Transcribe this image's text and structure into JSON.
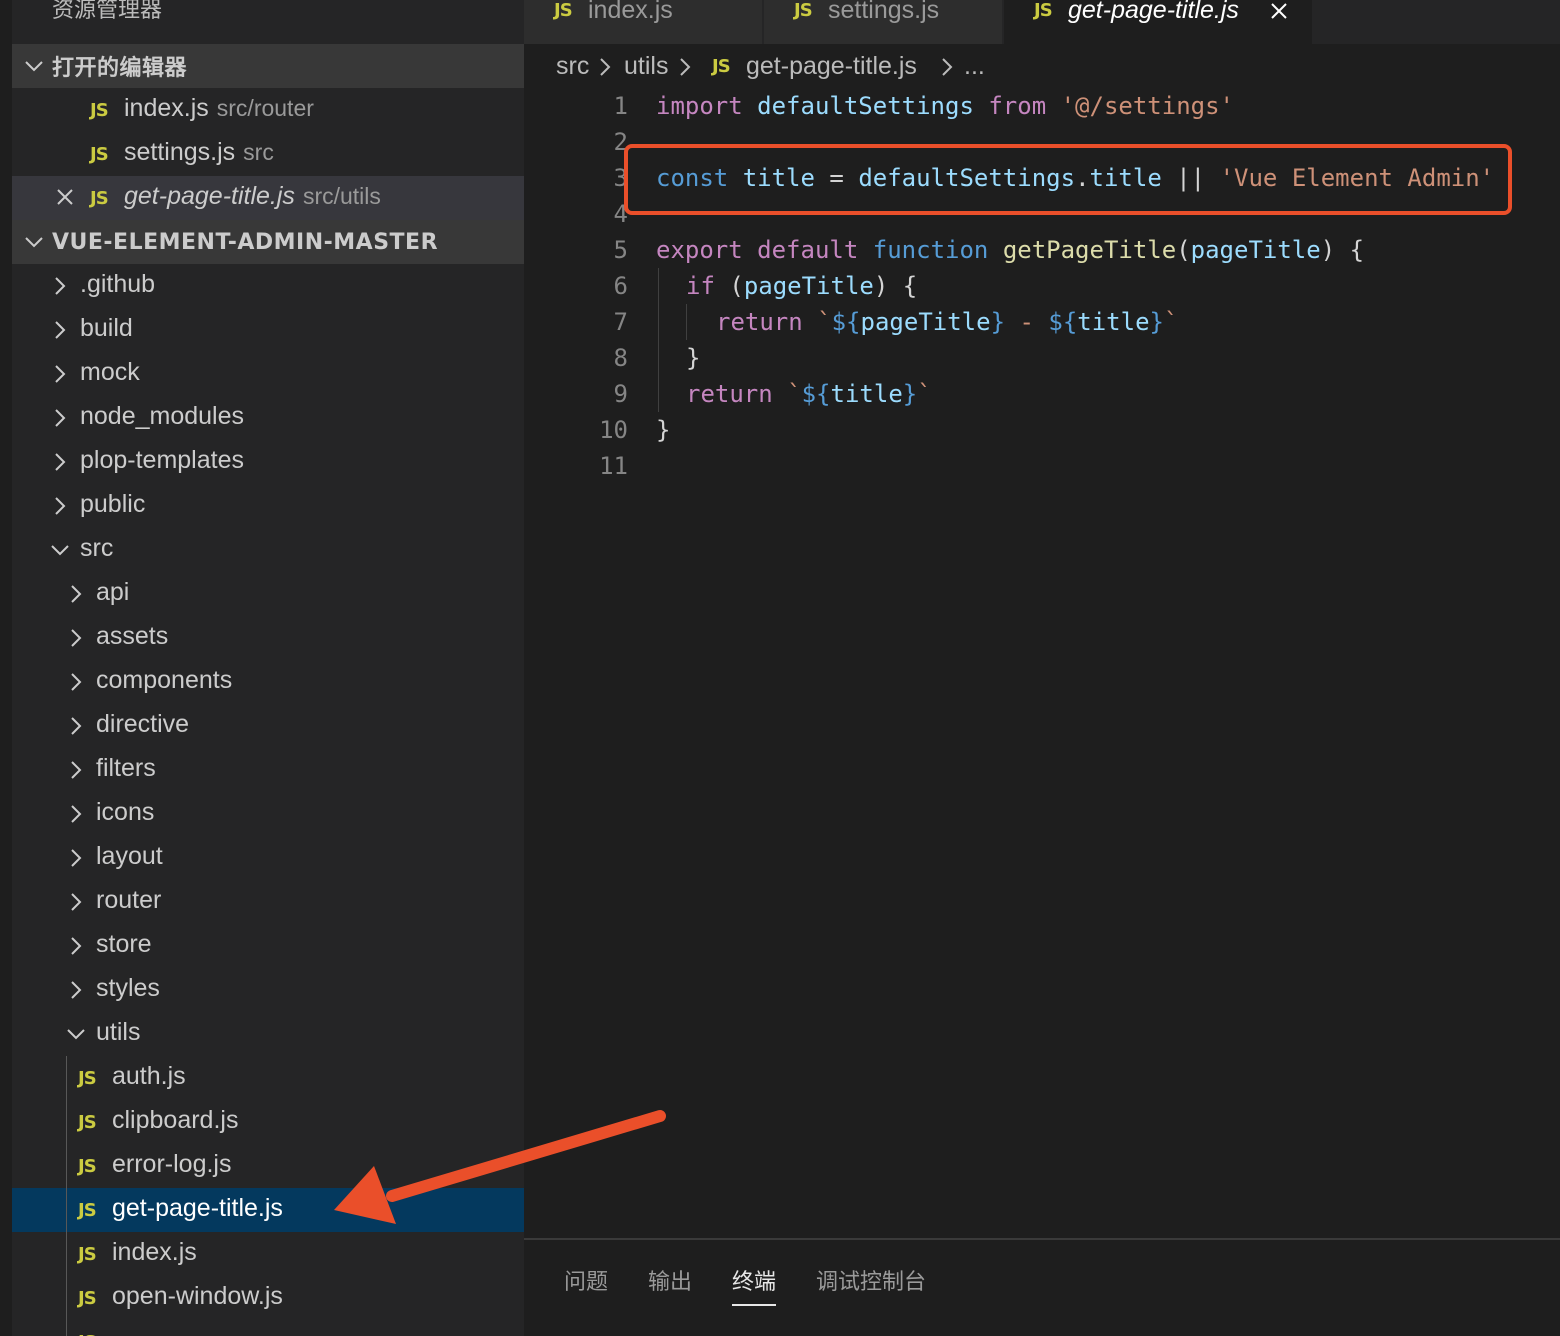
{
  "sidebar": {
    "title": "资源管理器",
    "open_editors": {
      "label": "打开的编辑器",
      "items": [
        {
          "name": "index.js",
          "path": "src/router"
        },
        {
          "name": "settings.js",
          "path": "src"
        },
        {
          "name": "get-page-title.js",
          "path": "src/utils"
        }
      ]
    },
    "project": {
      "label": "VUE-ELEMENT-ADMIN-MASTER",
      "folders": [
        ".github",
        "build",
        "mock",
        "node_modules",
        "plop-templates",
        "public"
      ],
      "src": "src",
      "src_folders": [
        "api",
        "assets",
        "components",
        "directive",
        "filters",
        "icons",
        "layout",
        "router",
        "store",
        "styles"
      ],
      "utils": "utils",
      "utils_files": [
        "auth.js",
        "clipboard.js",
        "error-log.js",
        "get-page-title.js",
        "index.js",
        "open-window.js"
      ]
    },
    "js_badge": "JS"
  },
  "tabs": [
    "index.js",
    "settings.js",
    "get-page-title.js"
  ],
  "breadcrumb": {
    "parts": [
      "src",
      "utils",
      "get-page-title.js",
      "..."
    ]
  },
  "editor": {
    "line_numbers": [
      "1",
      "2",
      "3",
      "4",
      "5",
      "6",
      "7",
      "8",
      "9",
      "10",
      "11"
    ],
    "code": {
      "l1": {
        "import": "import",
        "defaultSettings": "defaultSettings",
        "from": "from",
        "path": "'@/settings'"
      },
      "l3": {
        "const": "const",
        "title": "title",
        "eq": "=",
        "obj": "defaultSettings",
        "dot": ".",
        "prop": "title",
        "or": "||",
        "str": "'Vue Element Admin'"
      },
      "l5": {
        "export": "export",
        "default": "default",
        "function": "function",
        "name": "getPageTitle",
        "open": "(",
        "param": "pageTitle",
        "close": ") {"
      },
      "l6": {
        "if": "if",
        "open": "(",
        "param": "pageTitle",
        "close": ") {"
      },
      "l7": {
        "return": "return",
        "tick1": "`",
        "d1": "${",
        "v1": "pageTitle",
        "c1": "}",
        "dash": " - ",
        "d2": "${",
        "v2": "title",
        "c2": "}",
        "tick2": "`"
      },
      "l8": {
        "brace": "}"
      },
      "l9": {
        "return": "return",
        "tick1": "`",
        "d1": "${",
        "v1": "title",
        "c1": "}",
        "tick2": "`"
      },
      "l10": {
        "brace": "}"
      }
    }
  },
  "panel": {
    "tabs": [
      "问题",
      "输出",
      "终端",
      "调试控制台"
    ],
    "active": "终端"
  },
  "colors": {
    "highlight_box": "#ea4f2a",
    "arrow": "#ea4f2a",
    "selection": "#04395e",
    "js_badge": "#cbcb41"
  }
}
